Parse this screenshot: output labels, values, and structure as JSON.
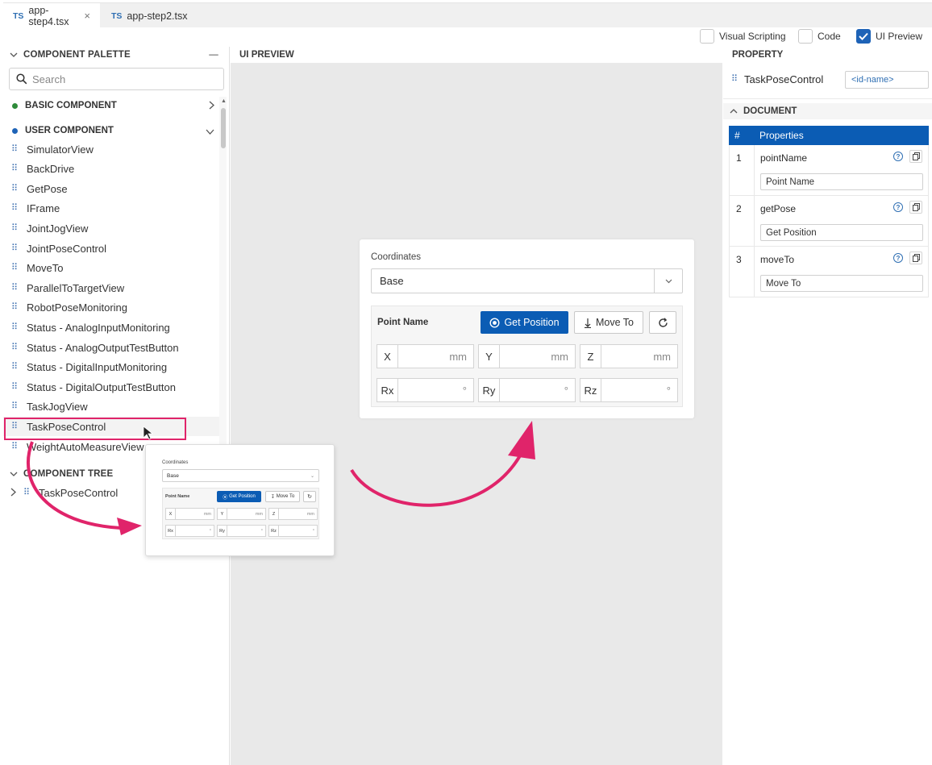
{
  "tabs": [
    {
      "prefix": "TS",
      "label": "app-step4.tsx",
      "close": "×"
    },
    {
      "prefix": "TS",
      "label": "app-step2.tsx"
    }
  ],
  "toolbar": {
    "visual_scripting": "Visual Scripting",
    "code": "Code",
    "ui_preview": "UI Preview",
    "ui_preview_checked": true
  },
  "palette": {
    "title": "COMPONENT PALETTE",
    "collapse_glyph": "—",
    "search_placeholder": "Search",
    "basic_group": "BASIC COMPONENT",
    "basic_color": "#2e8b3a",
    "user_group": "USER COMPONENT",
    "user_color": "#1e63b7",
    "items": [
      "SimulatorView",
      "BackDrive",
      "GetPose",
      "IFrame",
      "JointJogView",
      "JointPoseControl",
      "MoveTo",
      "ParallelToTargetView",
      "RobotPoseMonitoring",
      "Status - AnalogInputMonitoring",
      "Status - AnalogOutputTestButton",
      "Status - DigitalInputMonitoring",
      "Status - DigitalOutputTestButton",
      "TaskJogView",
      "TaskPoseControl",
      "WeightAutoMeasureView"
    ],
    "selected_item": "TaskPoseControl"
  },
  "tree": {
    "title": "COMPONENT TREE",
    "node": "TaskPoseControl"
  },
  "preview": {
    "title": "UI PREVIEW",
    "coordinates_label": "Coordinates",
    "coordinates_value": "Base",
    "point_name": "Point Name",
    "get_position": "Get Position",
    "move_to": "Move To",
    "fields": [
      {
        "key": "X",
        "unit": "mm"
      },
      {
        "key": "Y",
        "unit": "mm"
      },
      {
        "key": "Z",
        "unit": "mm"
      },
      {
        "key": "Rx",
        "unit": "°"
      },
      {
        "key": "Ry",
        "unit": "°"
      },
      {
        "key": "Rz",
        "unit": "°"
      }
    ]
  },
  "property": {
    "title": "PROPERTY",
    "component": "TaskPoseControl",
    "id_placeholder": "<id-name>",
    "document_title": "DOCUMENT",
    "col_num": "#",
    "col_props": "Properties",
    "rows": [
      {
        "num": "1",
        "name": "pointName",
        "value": "Point Name"
      },
      {
        "num": "2",
        "name": "getPose",
        "value": "Get Position"
      },
      {
        "num": "3",
        "name": "moveTo",
        "value": "Move To"
      }
    ]
  },
  "accent_colors": {
    "primary": "#0b5cb4",
    "arrow": "#e0246a"
  }
}
